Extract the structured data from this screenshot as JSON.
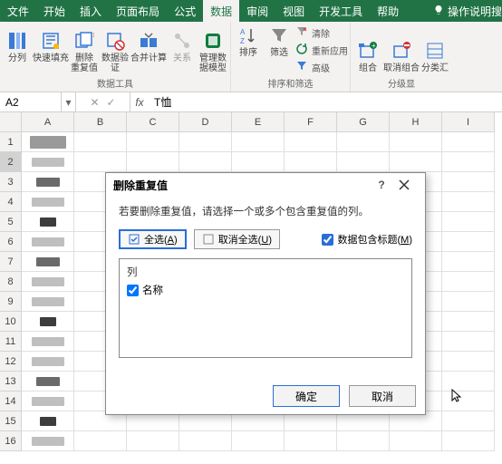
{
  "tabs": [
    "文件",
    "开始",
    "插入",
    "页面布局",
    "公式",
    "数据",
    "审阅",
    "视图",
    "开发工具",
    "帮助"
  ],
  "active_tab_index": 5,
  "tell_me": "操作说明搜",
  "ribbon": {
    "g1": {
      "text_to_cols": "分列",
      "flash_fill": "快速填充",
      "remove_dup": "删除\n重复值",
      "data_valid": "数据验\n证",
      "consolidate": "合并计算",
      "relations": "关系",
      "data_model": "管理数\n据模型",
      "group_name": "数据工具"
    },
    "g2": {
      "sort_az": "排序",
      "sort_btn": "排序",
      "filter": "筛选",
      "clear": "清除",
      "reapply": "重新应用",
      "advanced": "高级",
      "group_name": "排序和筛选"
    },
    "g3": {
      "group": "组合",
      "ungroup": "取消组合",
      "subtotal": "分类汇",
      "group_name": "分级显"
    }
  },
  "namebox": "A2",
  "formula": "T恤",
  "cols": [
    "A",
    "B",
    "C",
    "D",
    "E",
    "F",
    "G",
    "H",
    "I"
  ],
  "rows": 16,
  "dialog": {
    "title": "删除重复值",
    "msg": "若要删除重复值，请选择一个或多个包含重复值的列。",
    "select_all": "全选(A)",
    "unselect_all": "取消全选(U)",
    "has_header": "数据包含标题(M)",
    "col_header": "列",
    "col_item": "名称",
    "ok": "确定",
    "cancel": "取消"
  }
}
